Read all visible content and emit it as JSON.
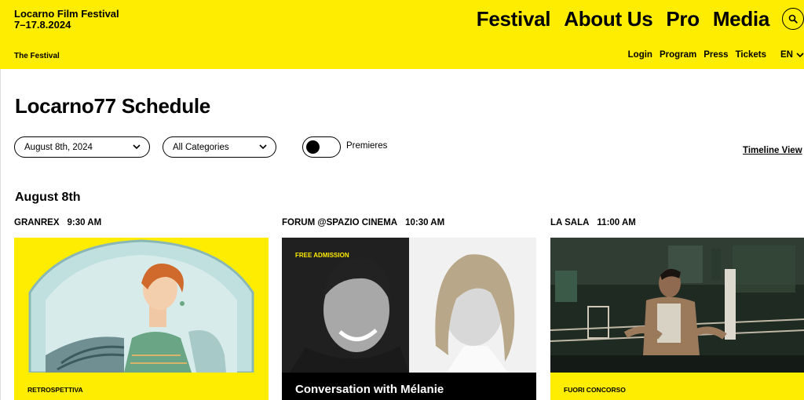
{
  "header": {
    "brand_name": "Locarno Film Festival",
    "brand_dates": "7–17.8.2024",
    "nav": [
      "Festival",
      "About Us",
      "Pro",
      "Media"
    ],
    "sub_left": "The Festival",
    "sub_nav": [
      "Login",
      "Program",
      "Press",
      "Tickets"
    ],
    "language": "EN",
    "search_icon": "search-icon"
  },
  "page": {
    "title": "Locarno77 Schedule",
    "date_select": "August 8th, 2024",
    "category_select": "All Categories",
    "toggle_label": "Premieres",
    "timeline_link": "Timeline View",
    "date_heading": "August 8th"
  },
  "cards": [
    {
      "venue": "GRANREX",
      "time": "9:30 AM",
      "tag": "RETROSPETTIVA"
    },
    {
      "venue": "FORUM @SPAZIO CINEMA",
      "time": "10:30 AM",
      "badge": "FREE ADMISSION",
      "title": "Conversation with Mélanie"
    },
    {
      "venue": "LA SALA",
      "time": "11:00 AM",
      "tag": "FUORI CONCORSO"
    }
  ],
  "colors": {
    "brand_yellow": "#ffed00",
    "black": "#000000"
  }
}
